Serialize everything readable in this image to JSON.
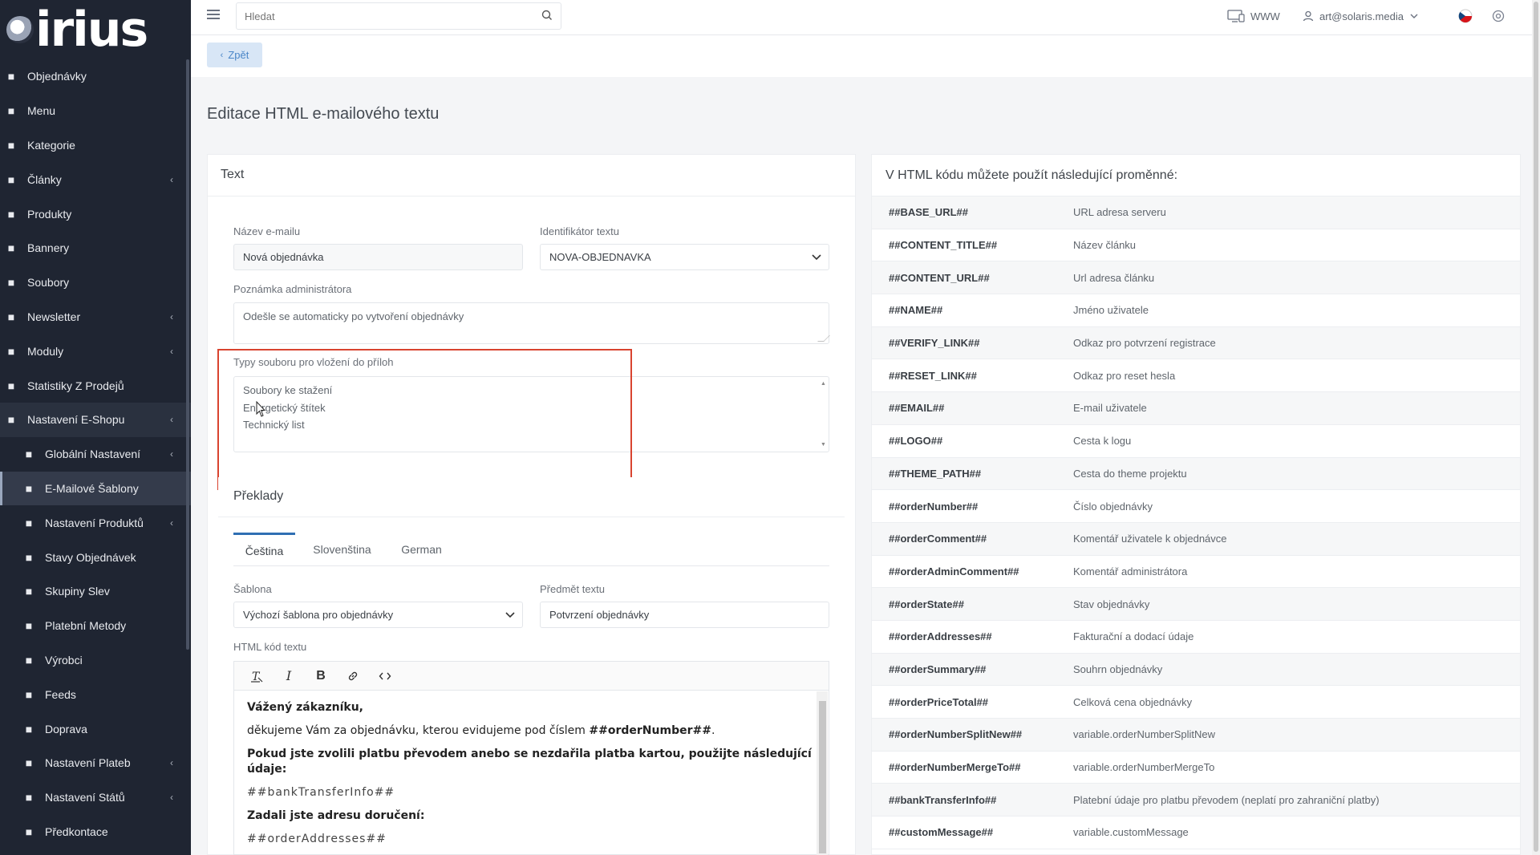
{
  "app": {
    "logo_text": "irius"
  },
  "sidebar": {
    "items": [
      {
        "label": "Objednávky",
        "icon": "cart-icon"
      },
      {
        "label": "Menu",
        "icon": "folder-icon"
      },
      {
        "label": "Kategorie",
        "icon": "list-icon"
      },
      {
        "label": "Články",
        "icon": "pen-icon",
        "has_children": true
      },
      {
        "label": "Produkty",
        "icon": "globe-icon"
      },
      {
        "label": "Bannery",
        "icon": "image-icon"
      },
      {
        "label": "Soubory",
        "icon": "file-icon"
      },
      {
        "label": "Newsletter",
        "icon": "ban-icon",
        "has_children": true
      },
      {
        "label": "Moduly",
        "icon": "puzzle-icon",
        "has_children": true
      },
      {
        "label": "Statistiky Z Prodejů",
        "icon": "chart-icon"
      },
      {
        "label": "Nastavení E-Shopu",
        "icon": "cogs-icon",
        "has_children": true,
        "open": true
      }
    ],
    "subitems": [
      {
        "label": "Globální Nastavení",
        "icon": "gear-icon",
        "has_children": true
      },
      {
        "label": "E-Mailové Šablony",
        "icon": "envelope-icon",
        "active": true
      },
      {
        "label": "Nastavení Produktů",
        "icon": "globe-icon",
        "has_children": true
      },
      {
        "label": "Stavy Objednávek",
        "icon": "bell-icon"
      },
      {
        "label": "Skupiny Slev",
        "icon": "tag-icon"
      },
      {
        "label": "Platební Metody",
        "icon": "card-icon"
      },
      {
        "label": "Výrobci",
        "icon": "building-icon"
      },
      {
        "label": "Feeds",
        "icon": "feed-icon"
      },
      {
        "label": "Doprava",
        "icon": "truck-icon"
      },
      {
        "label": "Nastavení Plateb",
        "icon": "card-icon",
        "has_children": true
      },
      {
        "label": "Nastavení Států",
        "icon": "flag-icon",
        "has_children": true
      },
      {
        "label": "Předkontace",
        "icon": "file-icon"
      }
    ]
  },
  "topbar": {
    "search_placeholder": "Hledat",
    "www_label": "WWW",
    "user_email": "art@solaris.media"
  },
  "back_label": "Zpět",
  "page_title": "Editace HTML e-mailového textu",
  "form": {
    "card_title": "Text",
    "email_name_label": "Název e-mailu",
    "email_name_value": "Nová objednávka",
    "identifier_label": "Identifikátor textu",
    "identifier_value": "NOVA-OBJEDNAVKA",
    "admin_note_label": "Poznámka administrátora",
    "admin_note_value": "Odešle se automaticky po vytvoření objednávky",
    "attachment_types_label": "Typy souboru pro vložení do příloh",
    "attachment_types": [
      "Soubory ke stažení",
      "Energetický štítek",
      "Technický list"
    ],
    "translations_title": "Překlady",
    "tabs": [
      "Čeština",
      "Slovenština",
      "German"
    ],
    "template_label": "Šablona",
    "template_value": "Výchozí šablona pro objednávky",
    "subject_label": "Předmět textu",
    "subject_value": "Potvrzení objednávky",
    "html_label": "HTML kód textu"
  },
  "editor": {
    "greeting": "Vážený zákazníku,",
    "thanks_prefix": "děkujeme Vám za objednávku, kterou evidujeme pod číslem ",
    "thanks_var": "##orderNumber##",
    "thanks_suffix": ".",
    "bank_heading": "Pokud jste zvolili platbu převodem anebo se nezdařila platba kartou, použijte následující údaje:",
    "bank_var": "##bankTransferInfo##",
    "address_heading": "Zadali jste adresu doručení:",
    "address_var": "##orderAddresses##"
  },
  "variables": {
    "title": "V HTML kódu můžete použít následující proměnné:",
    "rows": [
      {
        "name": "##BASE_URL##",
        "desc": "URL adresa serveru"
      },
      {
        "name": "##CONTENT_TITLE##",
        "desc": "Název článku"
      },
      {
        "name": "##CONTENT_URL##",
        "desc": "Url adresa článku"
      },
      {
        "name": "##NAME##",
        "desc": "Jméno uživatele"
      },
      {
        "name": "##VERIFY_LINK##",
        "desc": "Odkaz pro potvrzení registrace"
      },
      {
        "name": "##RESET_LINK##",
        "desc": "Odkaz pro reset hesla"
      },
      {
        "name": "##EMAIL##",
        "desc": "E-mail uživatele"
      },
      {
        "name": "##LOGO##",
        "desc": "Cesta k logu"
      },
      {
        "name": "##THEME_PATH##",
        "desc": "Cesta do theme projektu"
      },
      {
        "name": "##orderNumber##",
        "desc": "Číslo objednávky"
      },
      {
        "name": "##orderComment##",
        "desc": "Komentář uživatele k objednávce"
      },
      {
        "name": "##orderAdminComment##",
        "desc": "Komentář administrátora"
      },
      {
        "name": "##orderState##",
        "desc": "Stav objednávky"
      },
      {
        "name": "##orderAddresses##",
        "desc": "Fakturační a dodací údaje"
      },
      {
        "name": "##orderSummary##",
        "desc": "Souhrn objednávky"
      },
      {
        "name": "##orderPriceTotal##",
        "desc": "Celková cena objednávky"
      },
      {
        "name": "##orderNumberSplitNew##",
        "desc": "variable.orderNumberSplitNew"
      },
      {
        "name": "##orderNumberMergeTo##",
        "desc": "variable.orderNumberMergeTo"
      },
      {
        "name": "##bankTransferInfo##",
        "desc": "Platební údaje pro platbu převodem (neplatí pro zahraniční platby)"
      },
      {
        "name": "##customMessage##",
        "desc": "variable.customMessage"
      }
    ]
  },
  "colors": {
    "sidebar_bg": "#1f2532",
    "accent": "#2f6fb3",
    "highlight_box": "#d9432f",
    "back_button_bg": "#d8e6f6"
  }
}
